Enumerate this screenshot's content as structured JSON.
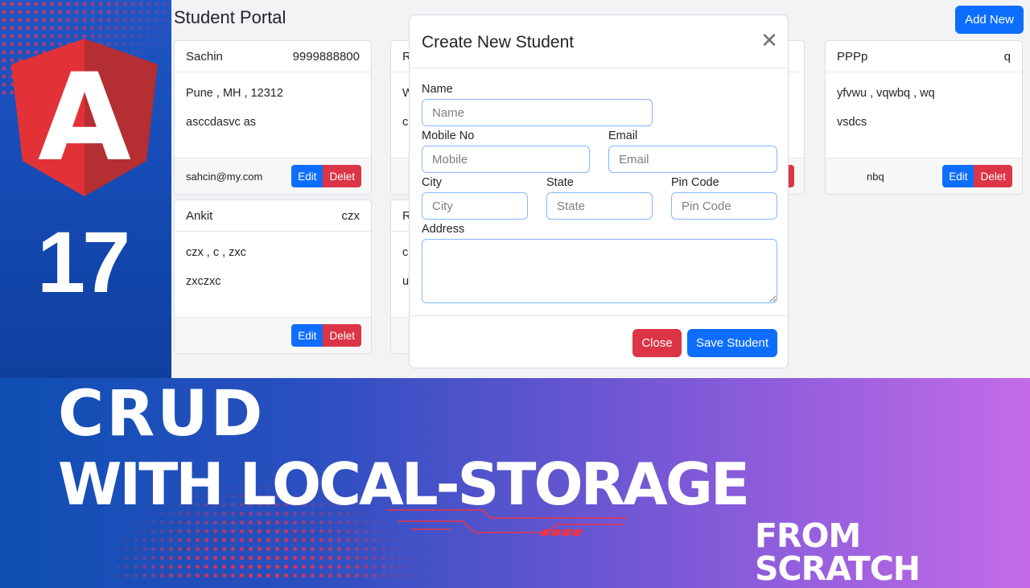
{
  "brand": {
    "logo_letter": "A",
    "version": "17",
    "logo_colors": {
      "light": "#dd0031",
      "dark": "#c3002f"
    },
    "icon": "angular-logo-icon"
  },
  "app": {
    "title": "Student Portal",
    "add_new_label": "Add New",
    "students": [
      {
        "name": "Sachin",
        "mobile": "9999888800",
        "address_line": "Pune , MH , 12312",
        "address": "asccdasvc as",
        "email": "sahcin@my.com"
      },
      {
        "name": "Ankit",
        "mobile": "czx",
        "address_line": "czx , c , zxc",
        "address": "zxczxc",
        "email": ""
      },
      {
        "name": "PPPp",
        "mobile": "q",
        "address_line": "yfvwu , vqwbq , wq",
        "address": "vsdcs",
        "email": "nbq"
      }
    ],
    "partial_cards": [
      {
        "header": "R",
        "line1": "W",
        "line2": "c"
      },
      {
        "header": "R",
        "line1": "c",
        "line2": "u"
      }
    ],
    "edit_label": "Edit",
    "delete_label": "Delet"
  },
  "modal": {
    "title": "Create New Student",
    "close_icon": "close-icon",
    "fields": {
      "name": {
        "label": "Name",
        "placeholder": "Name",
        "value": ""
      },
      "mobile": {
        "label": "Mobile No",
        "placeholder": "Mobile",
        "value": ""
      },
      "email": {
        "label": "Email",
        "placeholder": "Email",
        "value": ""
      },
      "city": {
        "label": "City",
        "placeholder": "City",
        "value": ""
      },
      "state": {
        "label": "State",
        "placeholder": "State",
        "value": ""
      },
      "pincode": {
        "label": "Pin Code",
        "placeholder": "Pin Code",
        "value": ""
      },
      "address": {
        "label": "Address",
        "placeholder": "",
        "value": ""
      }
    },
    "close_label": "Close",
    "save_label": "Save Student"
  },
  "headline": {
    "line1": "CRUD",
    "line2": "WITH LOCAL-STORAGE",
    "line3": "FROM SCRATCH"
  },
  "colors": {
    "primary": "#0d6efd",
    "danger": "#dc3545",
    "accent_red": "#e8344c",
    "gradient_start": "#0f4fb3",
    "gradient_end": "#c46be8"
  }
}
